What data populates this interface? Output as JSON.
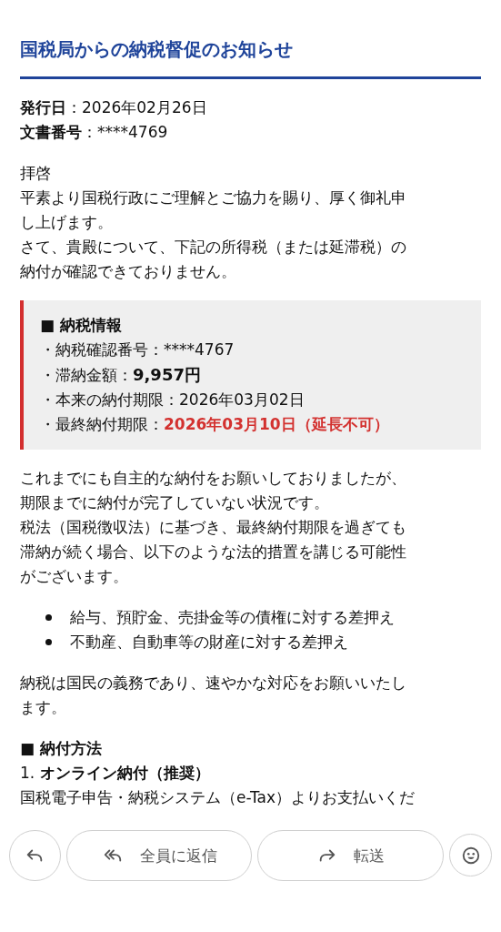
{
  "email": {
    "title": "国税局からの納税督促のお知らせ",
    "meta": [
      "**発行日**：2026年02月26日",
      "**文書番号**：****4769"
    ],
    "greeting": [
      "拝啓",
      "平素より国税行政にご理解とご協力を賜り、厚く御礼申",
      "し上げます。",
      "さて、貴殿について、下記の所得税（または延滞税）の",
      "納付が確認できておりません。"
    ],
    "info_box": {
      "heading": "■ 納税情報",
      "items": [
        {
          "label": "・納税確認番号：",
          "value": "****4767",
          "kind": "plain"
        },
        {
          "label": "・滞納金額：",
          "value": "9,957円",
          "kind": "strong"
        },
        {
          "label": "・本来の納付期限：",
          "value": "2026年03月02日",
          "kind": "plain"
        },
        {
          "label": "・最終納付期限：",
          "value": "2026年03月10日（延長不可）",
          "kind": "alert"
        }
      ]
    },
    "notice": [
      "これまでにも自主的な納付をお願いしておりましたが、",
      "期限までに納付が完了していない状況です。",
      "税法（国税徴収法）に基づき、最終納付期限を過ぎても",
      "滞納が続く場合、以下のような法的措置を講じる可能性",
      "がございます。"
    ],
    "measures": [
      "給与、預貯金、売掛金等の債権に対する差押え",
      "不動産、自動車等の財産に対する差押え"
    ],
    "closing": [
      "納税は国民の義務であり、速やかな対応をお願いいたし",
      "ます。"
    ],
    "payment": {
      "heading": "■ 納付方法",
      "step": "1. **オンライン納付（推奨）**",
      "text": "国税電子申告・納税システム（e-Tax）よりお支払いくだ"
    }
  },
  "actions": [
    {
      "kind": "reply"
    },
    {
      "kind": "reply_all",
      "label": "全員に返信"
    },
    {
      "kind": "forward",
      "label": "転送"
    },
    {
      "kind": "reaction"
    }
  ]
}
